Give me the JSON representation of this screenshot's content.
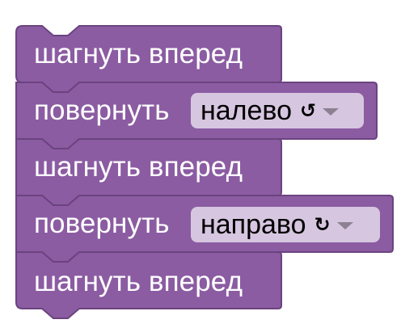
{
  "colors": {
    "block_fill": "#8b5ca2",
    "block_shadow": "#6b437f",
    "block_highlight": "#a57dba",
    "dropdown_fill": "#d7c6e0"
  },
  "blocks": [
    {
      "type": "move",
      "label": "шагнуть вперед"
    },
    {
      "type": "turn",
      "label": "повернуть",
      "dropdown": {
        "value": "налево",
        "icon": "↺",
        "icon_name": "rotate-left-icon"
      }
    },
    {
      "type": "move",
      "label": "шагнуть вперед"
    },
    {
      "type": "turn",
      "label": "повернуть",
      "dropdown": {
        "value": "направо",
        "icon": "↻",
        "icon_name": "rotate-right-icon"
      }
    },
    {
      "type": "move",
      "label": "шагнуть вперед"
    }
  ]
}
